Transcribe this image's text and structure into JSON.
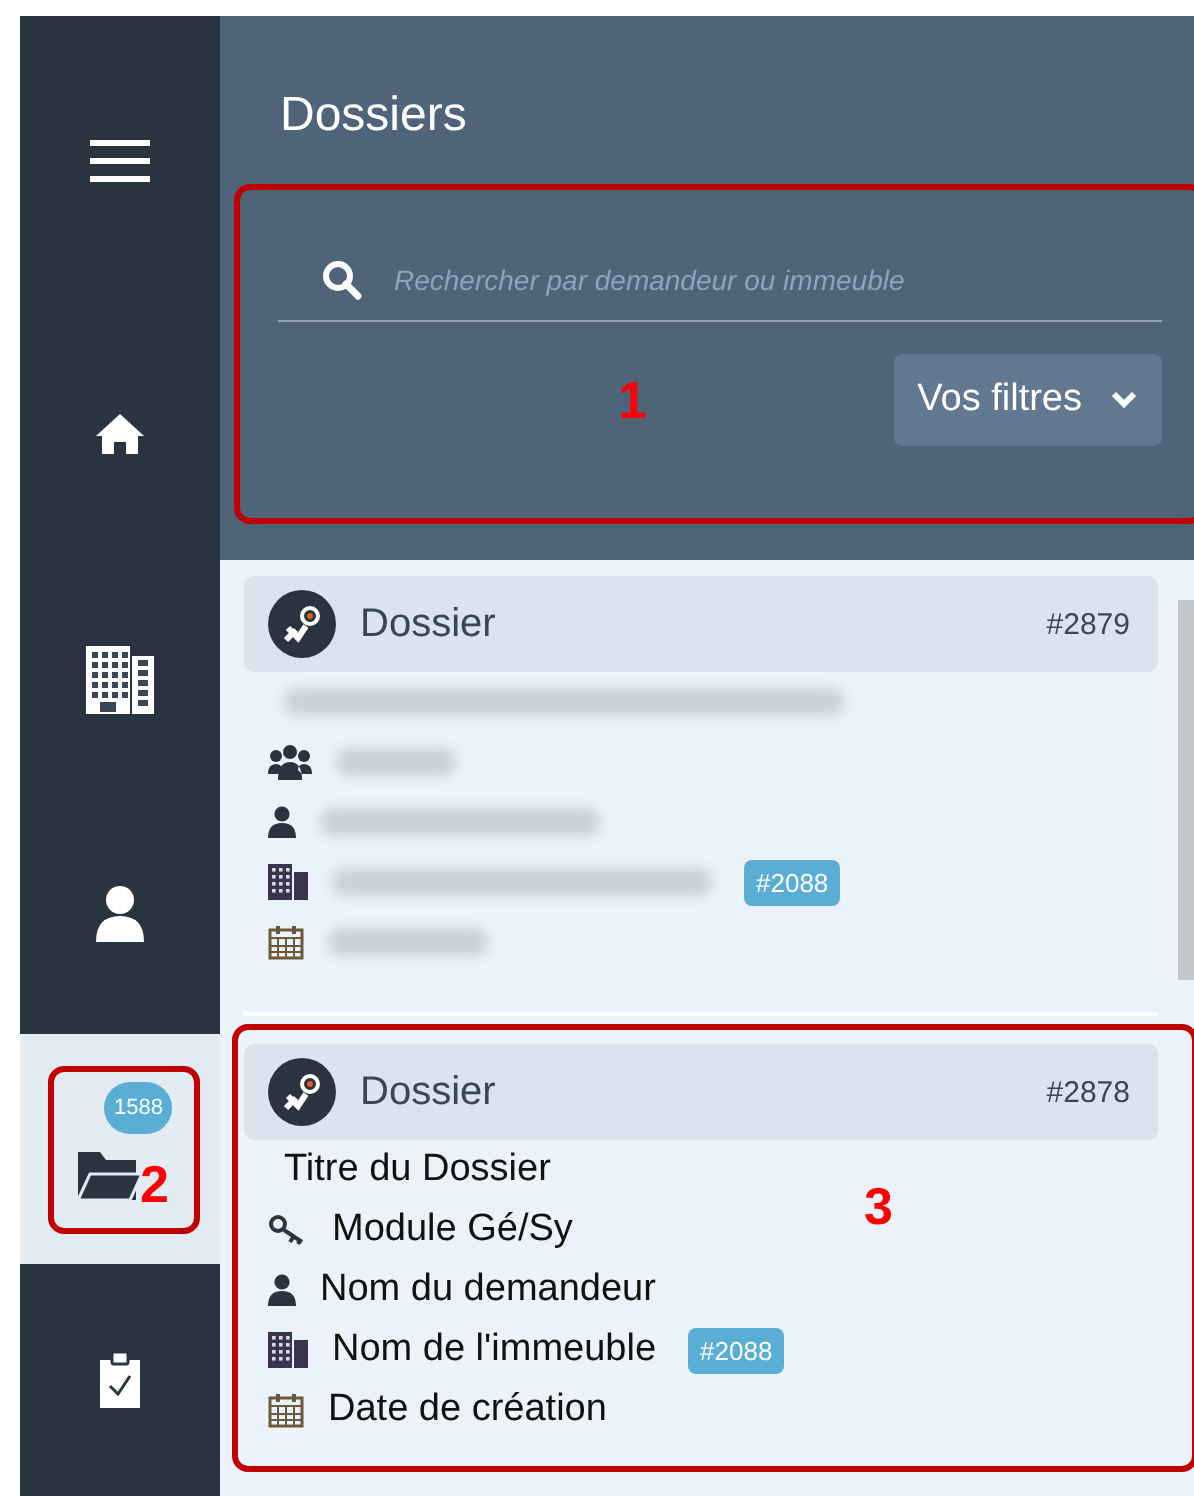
{
  "sidebar": {
    "items": [
      {
        "kind": "menu",
        "selected": false
      },
      {
        "kind": "home",
        "selected": false
      },
      {
        "kind": "buildings",
        "selected": false
      },
      {
        "kind": "user",
        "selected": false
      },
      {
        "kind": "folder",
        "selected": true,
        "badge": "1588",
        "annotation": "2"
      },
      {
        "kind": "clipboard",
        "selected": false
      }
    ]
  },
  "header": {
    "title": "Dossiers"
  },
  "filter_panel": {
    "annotation": "1",
    "search": {
      "placeholder": "Rechercher par demandeur ou immeuble"
    },
    "filters_button": "Vos filtres"
  },
  "cards": [
    {
      "title": "Dossier",
      "number": "#2879",
      "fields": [
        {
          "kind": "title"
        },
        {
          "kind": "group"
        },
        {
          "kind": "person"
        },
        {
          "kind": "building",
          "tag": "#2088"
        },
        {
          "kind": "date"
        }
      ]
    },
    {
      "title": "Dossier",
      "number": "#2878",
      "annotation": "3",
      "fields": [
        {
          "kind": "title",
          "value": "Titre du Dossier"
        },
        {
          "kind": "module",
          "value": "Module Gé/Sy"
        },
        {
          "kind": "person",
          "value": "Nom du demandeur"
        },
        {
          "kind": "building",
          "value": "Nom de l'immeuble",
          "tag": "#2088"
        },
        {
          "kind": "date",
          "value": "Date de création"
        }
      ]
    }
  ]
}
